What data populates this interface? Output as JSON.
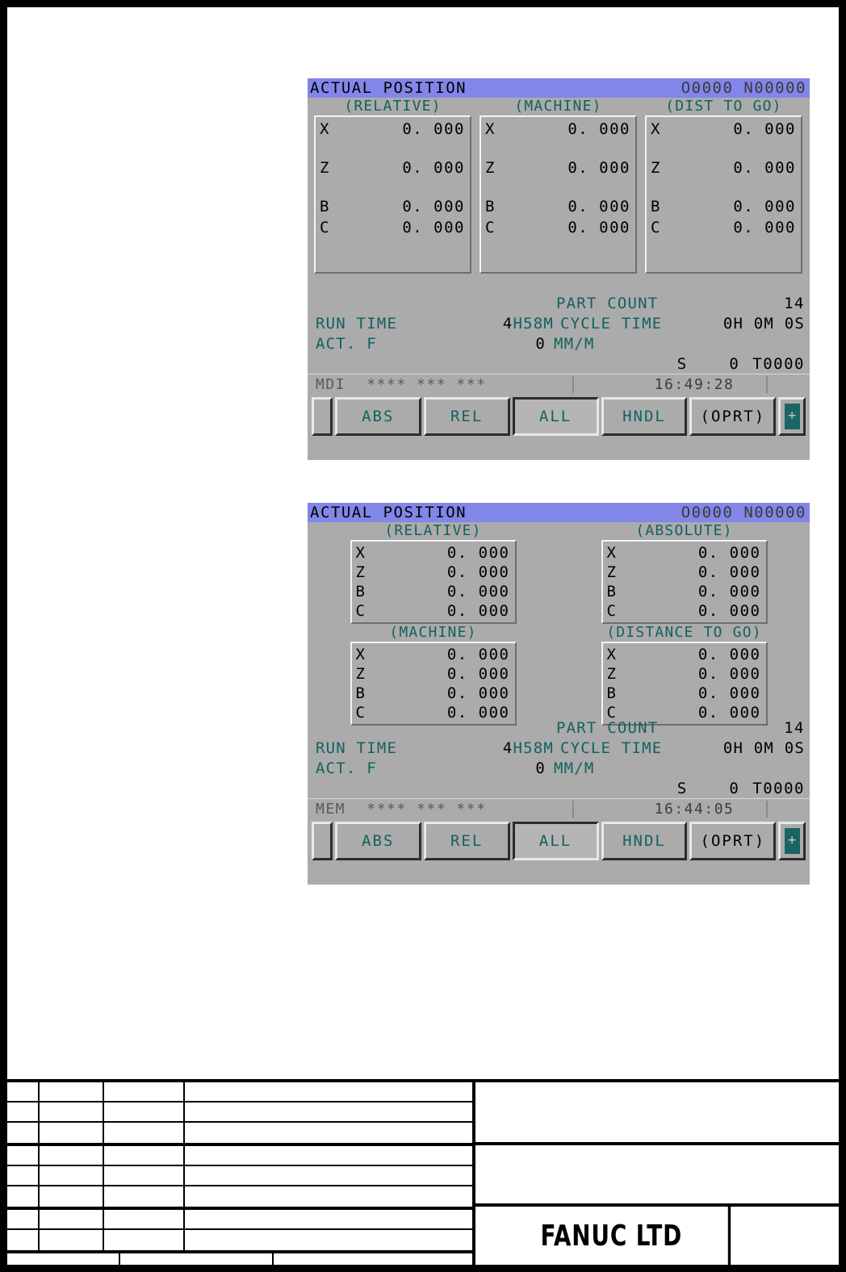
{
  "sheet": {
    "company": "FANUC  LTD"
  },
  "screens": [
    {
      "id": "screen-mdi-three-column",
      "title": "ACTUAL POSITION",
      "program_no": "O0000  N00000",
      "layout": "three-column",
      "groups": [
        {
          "label": "(RELATIVE)",
          "axes": [
            {
              "name": "X",
              "value": "0. 000"
            },
            {
              "name": "Z",
              "value": "0. 000"
            },
            {
              "name": "B",
              "value": "0. 000"
            },
            {
              "name": "C",
              "value": "0. 000"
            }
          ]
        },
        {
          "label": "(MACHINE)",
          "axes": [
            {
              "name": "X",
              "value": "0. 000"
            },
            {
              "name": "Z",
              "value": "0. 000"
            },
            {
              "name": "B",
              "value": "0. 000"
            },
            {
              "name": "C",
              "value": "0. 000"
            }
          ]
        },
        {
          "label": "(DIST TO GO)",
          "axes": [
            {
              "name": "X",
              "value": "0. 000"
            },
            {
              "name": "Z",
              "value": "0. 000"
            },
            {
              "name": "B",
              "value": "0. 000"
            },
            {
              "name": "C",
              "value": "0. 000"
            }
          ]
        }
      ],
      "info": {
        "part_count_label": "PART COUNT",
        "part_count_value": "14",
        "run_time_label": "RUN  TIME",
        "run_time_value_num": "4",
        "run_time_value_unit": "H58M",
        "cycle_time_label": "CYCLE  TIME",
        "cycle_time_value": "0H 0M 0S",
        "act_f_label": "ACT. F",
        "act_f_value": "0",
        "act_f_unit": "MM/M",
        "s_label": "S",
        "s_value": "0",
        "t_value": "T0000"
      },
      "status": {
        "mode": "MDI",
        "flags": "****  ***  ***",
        "time_hh": "16",
        "time_mm": "49",
        "time_ss": "28",
        "time_sep": ":"
      },
      "softkeys": [
        {
          "label": "ABS",
          "selected": false
        },
        {
          "label": "REL",
          "selected": false
        },
        {
          "label": "ALL",
          "selected": true
        },
        {
          "label": "HNDL",
          "selected": false
        },
        {
          "label": "(OPRT)",
          "selected": false
        }
      ],
      "next_menu_glyph": "+"
    },
    {
      "id": "screen-mem-quad",
      "title": "ACTUAL POSITION",
      "program_no": "O0000  N00000",
      "layout": "quad",
      "groups": [
        {
          "label": "(RELATIVE)",
          "axes": [
            {
              "name": "X",
              "value": "0. 000"
            },
            {
              "name": "Z",
              "value": "0. 000"
            },
            {
              "name": "B",
              "value": "0. 000"
            },
            {
              "name": "C",
              "value": "0. 000"
            }
          ]
        },
        {
          "label": "(ABSOLUTE)",
          "axes": [
            {
              "name": "X",
              "value": "0. 000"
            },
            {
              "name": "Z",
              "value": "0. 000"
            },
            {
              "name": "B",
              "value": "0. 000"
            },
            {
              "name": "C",
              "value": "0. 000"
            }
          ]
        },
        {
          "label": "(MACHINE)",
          "axes": [
            {
              "name": "X",
              "value": "0. 000"
            },
            {
              "name": "Z",
              "value": "0. 000"
            },
            {
              "name": "B",
              "value": "0. 000"
            },
            {
              "name": "C",
              "value": "0. 000"
            }
          ]
        },
        {
          "label": "(DISTANCE TO GO)",
          "axes": [
            {
              "name": "X",
              "value": "0. 000"
            },
            {
              "name": "Z",
              "value": "0. 000"
            },
            {
              "name": "B",
              "value": "0. 000"
            },
            {
              "name": "C",
              "value": "0. 000"
            }
          ]
        }
      ],
      "info": {
        "part_count_label": "PART COUNT",
        "part_count_value": "14",
        "run_time_label": "RUN  TIME",
        "run_time_value_num": "4",
        "run_time_value_unit": "H58M",
        "cycle_time_label": "CYCLE  TIME",
        "cycle_time_value": "0H 0M 0S",
        "act_f_label": "ACT. F",
        "act_f_value": "0",
        "act_f_unit": "MM/M",
        "s_label": "S",
        "s_value": "0",
        "t_value": "T0000"
      },
      "status": {
        "mode": "MEM",
        "flags": "****  ***  ***",
        "time_hh": "16",
        "time_mm": "44",
        "time_ss": "05",
        "time_sep": ":"
      },
      "softkeys": [
        {
          "label": "ABS",
          "selected": false
        },
        {
          "label": "REL",
          "selected": false
        },
        {
          "label": "ALL",
          "selected": true
        },
        {
          "label": "HNDL",
          "selected": false
        },
        {
          "label": "(OPRT)",
          "selected": false
        }
      ],
      "next_menu_glyph": "+"
    }
  ],
  "colors": {
    "titlebar": "#8186e8",
    "screen_bg": "#ababab",
    "accent_teal": "#14615e",
    "text_black": "#000000",
    "status_text": "#5a5a5a"
  }
}
